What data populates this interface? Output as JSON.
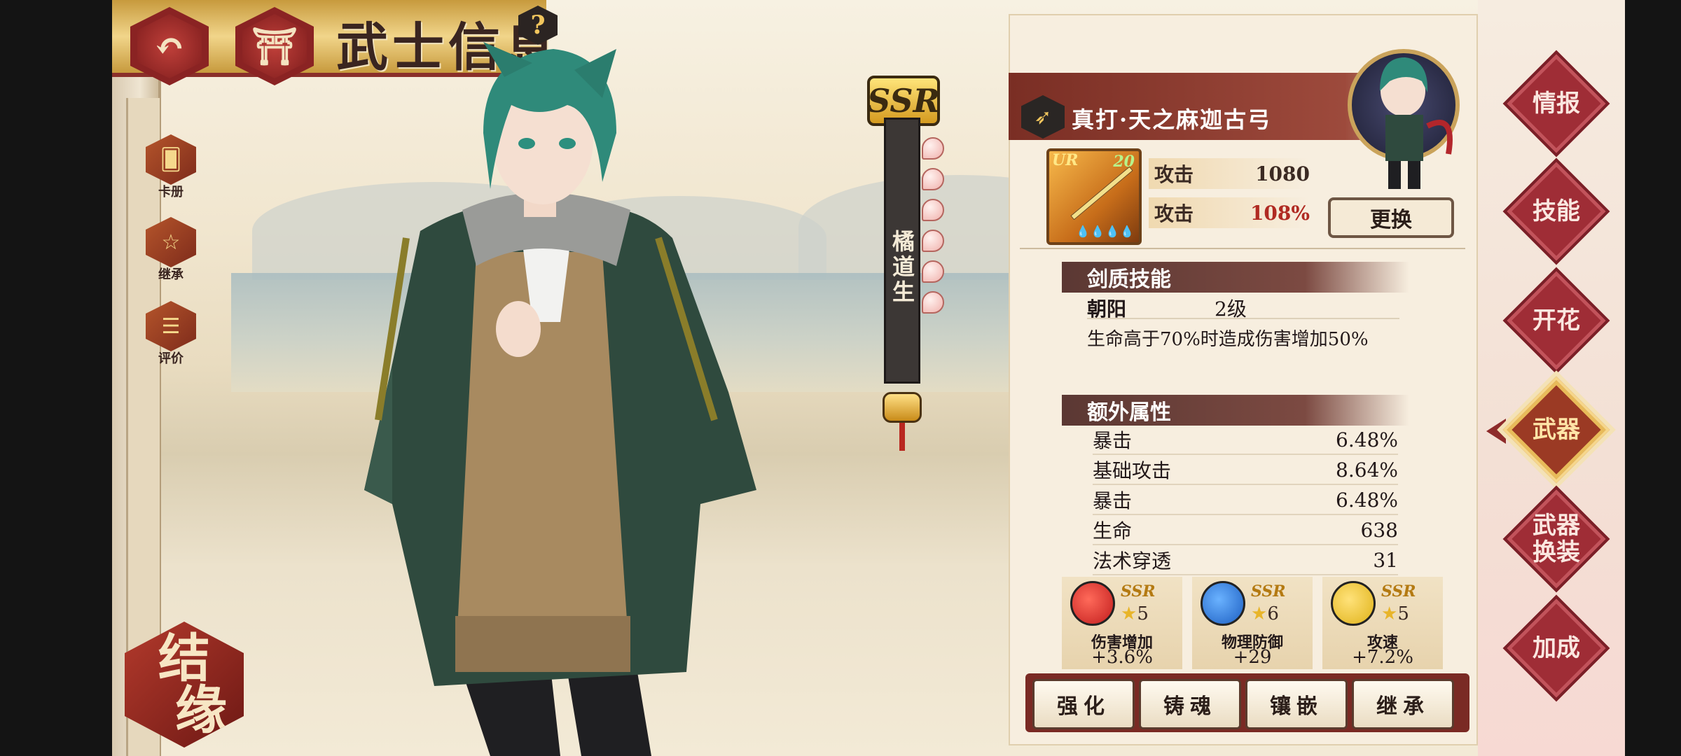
{
  "header": {
    "title": "武士信息",
    "back_icon": "back-arrow-icon",
    "home_icon": "torii-gate-icon",
    "help_label": "?"
  },
  "left_menu": [
    {
      "label": "卡册",
      "icon": "card-album-icon"
    },
    {
      "label": "继承",
      "icon": "pentagram-icon"
    },
    {
      "label": "评价",
      "icon": "review-icon"
    }
  ],
  "bond_button": {
    "line1": "结",
    "line2": "缘"
  },
  "character": {
    "rarity": "SSR",
    "name": "橘道生"
  },
  "weapon": {
    "name": "真打·天之麻迦古弓",
    "rarity": "UR",
    "level": "20",
    "stats": [
      {
        "label": "攻击",
        "value": "1080"
      },
      {
        "label": "攻击",
        "value": "108%"
      }
    ],
    "change_label": "更换"
  },
  "sword_skill": {
    "section_title": "剑质技能",
    "name": "朝阳",
    "level": "2级",
    "description": "生命高于70%时造成伤害增加50%"
  },
  "extra_attributes": {
    "section_title": "额外属性",
    "rows": [
      {
        "label": "暴击",
        "value": "6.48%"
      },
      {
        "label": "基础攻击",
        "value": "8.64%"
      },
      {
        "label": "暴击",
        "value": "6.48%"
      },
      {
        "label": "生命",
        "value": "638"
      },
      {
        "label": "法术穿透",
        "value": "31"
      }
    ]
  },
  "gems": [
    {
      "rarity": "SSR",
      "stars": "5",
      "name": "伤害增加",
      "bonus": "+3.6%",
      "color": "#c21d1d"
    },
    {
      "rarity": "SSR",
      "stars": "6",
      "name": "物理防御",
      "bonus": "+29",
      "color": "#1d5fc2"
    },
    {
      "rarity": "SSR",
      "stars": "5",
      "name": "攻速",
      "bonus": "+7.2%",
      "color": "#e0b218"
    }
  ],
  "actions": [
    "强化",
    "铸魂",
    "镶嵌",
    "继承"
  ],
  "side_tabs": [
    {
      "label": "情报",
      "active": false
    },
    {
      "label": "技能",
      "active": false
    },
    {
      "label": "开花",
      "active": false
    },
    {
      "label": "武器",
      "active": true
    },
    {
      "label": "武器换装",
      "active": false
    },
    {
      "label": "加成",
      "active": false
    }
  ]
}
